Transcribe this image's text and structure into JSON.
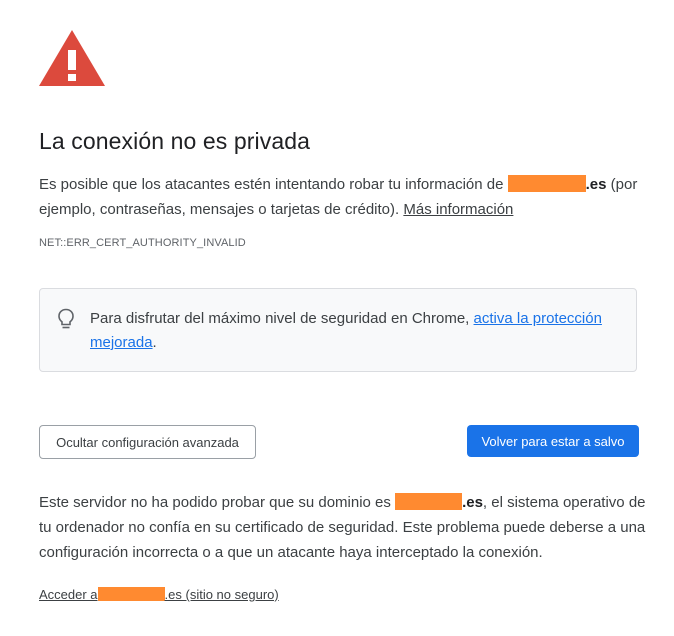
{
  "interstitial": {
    "heading": "La conexión no es privada",
    "explanation": {
      "before": "Es posible que los atacantes estén intentando robar tu información de ",
      "domain_suffix": ".es",
      "after": " (por ejemplo, contraseñas, mensajes o tarjetas de crédito). ",
      "learn_more": "Más información"
    },
    "error_code": "NET::ERR_CERT_AUTHORITY_INVALID",
    "enhanced_protection": {
      "text_before": "Para disfrutar del máximo nivel de seguridad en Chrome, ",
      "link": "activa la protección mejorada",
      "text_after": "."
    },
    "buttons": {
      "advanced": "Ocultar configuración avanzada",
      "back_to_safety": "Volver para estar a salvo"
    },
    "details": {
      "before": "Este servidor no ha podido probar que su dominio es ",
      "domain_suffix": ".es",
      "after": ", el sistema operativo de tu ordenador no confía en su certificado de seguridad. Este problema puede deberse a una configuración incorrecta o a que un atacante haya interceptado la conexión."
    },
    "proceed": {
      "prefix": "Acceder a",
      "suffix": ".es (sitio no seguro)"
    },
    "colors": {
      "warning_red": "#dc4a3d",
      "primary_blue": "#1a73e8",
      "redaction_orange": "#ff8a30"
    }
  }
}
